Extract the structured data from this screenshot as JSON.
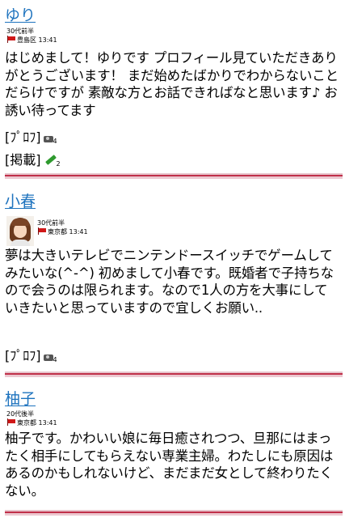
{
  "posts": [
    {
      "name": "ゆり",
      "age": "30代前半",
      "location": "豊島区 13:41",
      "body": "はじめまして！ゆりです プロフィール見ていただきありがとうございます！ まだ始めたばかりでわからないことだらけですが 素敵な方とお話できればなと思います♪ お誘い待ってます",
      "profile_link": "[ﾌﾟﾛﾌ]",
      "photo_count": "4",
      "board_link": "[掲載]",
      "board_count": "2"
    },
    {
      "name": "小春",
      "age": "30代前半",
      "location": "東京都 13:41",
      "body": "夢は大きいテレビでニンテンドースイッチでゲームしてみたいな(^-^) 初めまして小春です。既婚者で子持ちなので会うのは限られます。なので1人の方を大事にしていきたいと思っていますので宜しくお願い..",
      "profile_link": "[ﾌﾟﾛﾌ]",
      "photo_count": "4"
    },
    {
      "name": "柚子",
      "age": "20代後半",
      "location": "東京都 13:41",
      "body": "柚子です。かわいい娘に毎日癒されつつ、旦那にはまったく相手にしてもらえない専業主婦。わたしにも原因はあるのかもしれないけど、まだまだ女として終わりたくない。"
    }
  ],
  "colors": {
    "link": "#1e73be",
    "divider": "#c0304a"
  }
}
